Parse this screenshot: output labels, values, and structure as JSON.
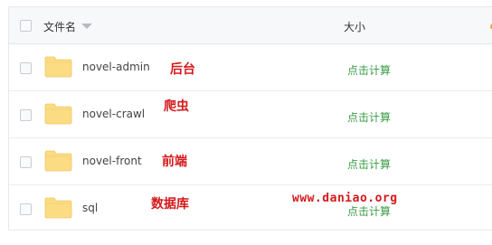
{
  "header": {
    "name_label": "文件名",
    "size_label": "大小"
  },
  "rows": [
    {
      "name": "novel-admin",
      "annotation": "后台",
      "size_action": "点击计算"
    },
    {
      "name": "novel-crawl",
      "annotation": "爬虫",
      "size_action": "点击计算"
    },
    {
      "name": "novel-front",
      "annotation": "前端",
      "size_action": "点击计算"
    },
    {
      "name": "sql",
      "annotation": "数据库",
      "size_action": "点击计算"
    }
  ],
  "watermark": "www.daniao.org",
  "colors": {
    "folder": "#fbdc83",
    "action_link": "#3a9b45",
    "annotation": "#d4191c"
  },
  "icons": {
    "folder": "folder-icon",
    "sort": "sort-caret-icon"
  }
}
